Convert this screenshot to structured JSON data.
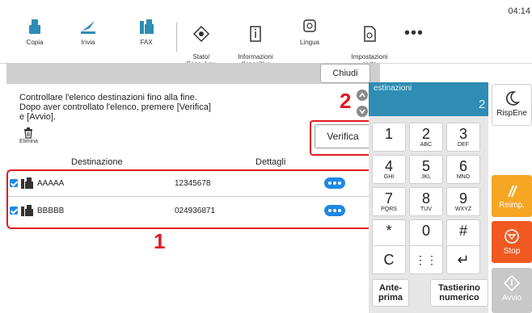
{
  "status": {
    "time": "04:14"
  },
  "toolbar": {
    "items": [
      {
        "label": "Copia"
      },
      {
        "label": "Invia"
      },
      {
        "label": "FAX"
      },
      {
        "label": "Stato/\nCanc. Lav."
      },
      {
        "label": "Informazioni\ndispositivo"
      },
      {
        "label": "Lingua"
      },
      {
        "label": "Impostazioni\ncarta"
      }
    ],
    "more": "•••"
  },
  "panel": {
    "close_label": "Chiudi",
    "message": "Controllare l'elenco destinazioni fino alla fine.\nDopo aver controllato l'elenco, premere [Verifica]\ne [Avvio].",
    "delete_label": "Elimina",
    "verify_label": "Verifica",
    "columns": [
      "Destinazione",
      "Dettagli"
    ],
    "rows": [
      {
        "name": "AAAAA",
        "detail": "12345678",
        "checked": true
      },
      {
        "name": "BBBBB",
        "detail": "024936871",
        "checked": true
      }
    ],
    "callouts": [
      "1",
      "2"
    ]
  },
  "keypad": {
    "dest_label": "estinazioni",
    "dest_count": "2",
    "keys": [
      {
        "main": "1",
        "sub": ""
      },
      {
        "main": "2",
        "sub": "ABC"
      },
      {
        "main": "3",
        "sub": "DEF"
      },
      {
        "main": "4",
        "sub": "GHI"
      },
      {
        "main": "5",
        "sub": "JKL"
      },
      {
        "main": "6",
        "sub": "MNO"
      },
      {
        "main": "7",
        "sub": "PQRS"
      },
      {
        "main": "8",
        "sub": "TUV"
      },
      {
        "main": "9",
        "sub": "WXYZ"
      },
      {
        "main": "*",
        "sub": ""
      },
      {
        "main": "0",
        "sub": ""
      },
      {
        "main": "#",
        "sub": ""
      },
      {
        "main": "C",
        "sub": ""
      },
      {
        "main": "⋮⋮",
        "sub": ""
      },
      {
        "main": "↵",
        "sub": ""
      }
    ],
    "ante_prima": "Ante-\nprima",
    "tastierino": "Tastierino\nnumerico"
  },
  "side": {
    "rispene_label": "RispEne",
    "reimp_label": "Reimp.",
    "stop_label": "Stop",
    "avvio_label": "Avvio"
  },
  "colors": {
    "accent": "#2f8cb4",
    "highlight": "#e11b22",
    "stop": "#f05a22",
    "reset": "#f5a623",
    "check": "#1e88e5"
  }
}
